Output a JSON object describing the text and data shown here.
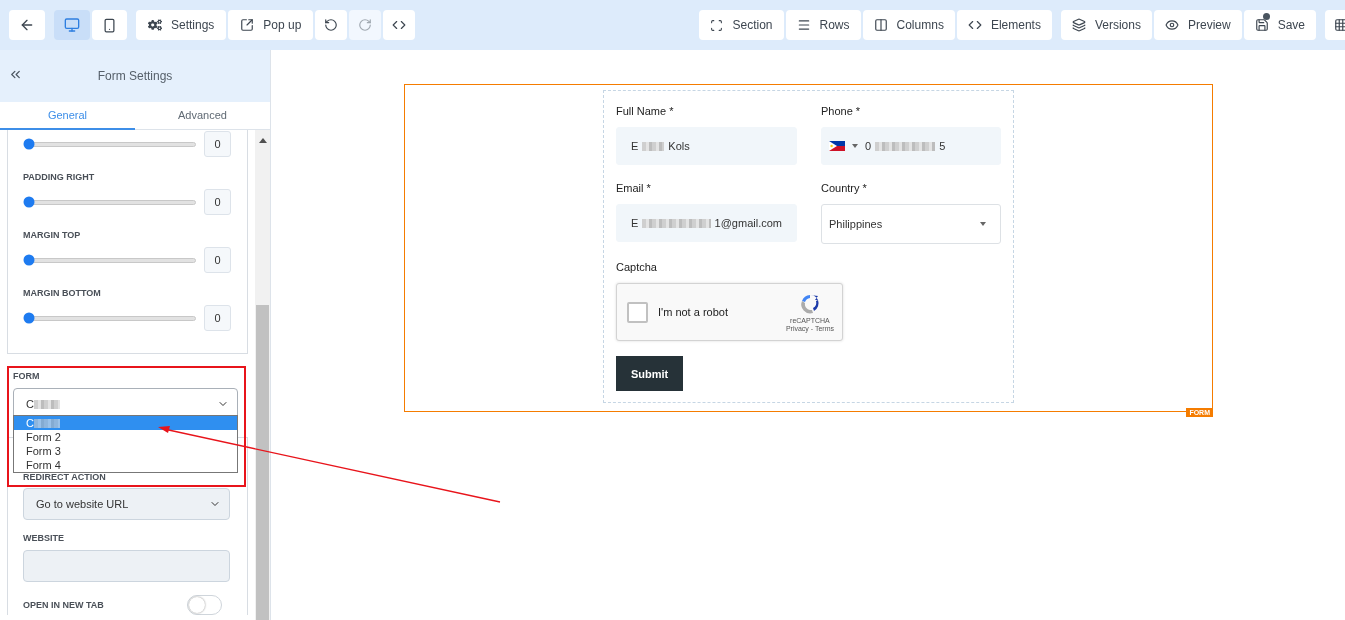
{
  "toolbar": {
    "device_buttons": [
      {
        "selected": true
      },
      {
        "selected": false
      }
    ],
    "edit_buttons": [
      {
        "label": "Settings",
        "disabled": false
      },
      {
        "label": "Pop up",
        "disabled": false
      },
      {
        "disabled": false
      },
      {
        "disabled": true
      },
      {
        "disabled": false
      }
    ],
    "structure_buttons": [
      {
        "label": "Section"
      },
      {
        "label": "Rows"
      },
      {
        "label": "Columns"
      },
      {
        "label": "Elements"
      }
    ],
    "publish_buttons": [
      {
        "label": "Versions"
      },
      {
        "label": "Preview"
      },
      {
        "label": "Save",
        "badge": true
      }
    ]
  },
  "sidebar": {
    "title": "Form Settings",
    "tabs": [
      {
        "label": "General",
        "selected": true
      },
      {
        "label": "Advanced",
        "selected": false
      }
    ],
    "sliders": [
      {
        "level": 0,
        "value": "0"
      },
      {
        "label": "PADDING RIGHT",
        "level": 0,
        "value": "0"
      },
      {
        "label": "MARGIN TOP",
        "level": 0,
        "value": "0"
      },
      {
        "label": "MARGIN BOTTOM",
        "level": 0,
        "value": "0"
      }
    ],
    "form_select": {
      "label": "FORM",
      "value": "C",
      "expanded": true,
      "options": [
        {
          "label": "C",
          "selected": true
        },
        {
          "label": "Form 2",
          "selected": false
        },
        {
          "label": "Form 3",
          "selected": false
        },
        {
          "label": "Form 4",
          "selected": false
        }
      ]
    },
    "redirect_action": {
      "label": "REDIRECT ACTION",
      "value": "Go to website URL"
    },
    "website": {
      "label": "WEBSITE"
    },
    "open_in_new_tab": {
      "label": "OPEN IN NEW TAB",
      "on": false
    }
  },
  "canvas": {
    "form_tag": "FORM",
    "fields": [
      {
        "kind": "text",
        "label": "Full Name *",
        "value_start": "E",
        "value_end": "Kols"
      },
      {
        "kind": "phone",
        "label": "Phone *",
        "value_start": "0",
        "value_end": "5"
      },
      {
        "kind": "text",
        "label": "Email *",
        "value_start": "E",
        "value_end": "1@gmail.com"
      },
      {
        "kind": "select",
        "label": "Country *",
        "value": "Philippines"
      }
    ],
    "captcha": {
      "label": "Captcha",
      "text": "I'm not a robot",
      "brand": "reCAPTCHA",
      "links": "Privacy - Terms",
      "checked": false
    },
    "submit": "Submit"
  }
}
